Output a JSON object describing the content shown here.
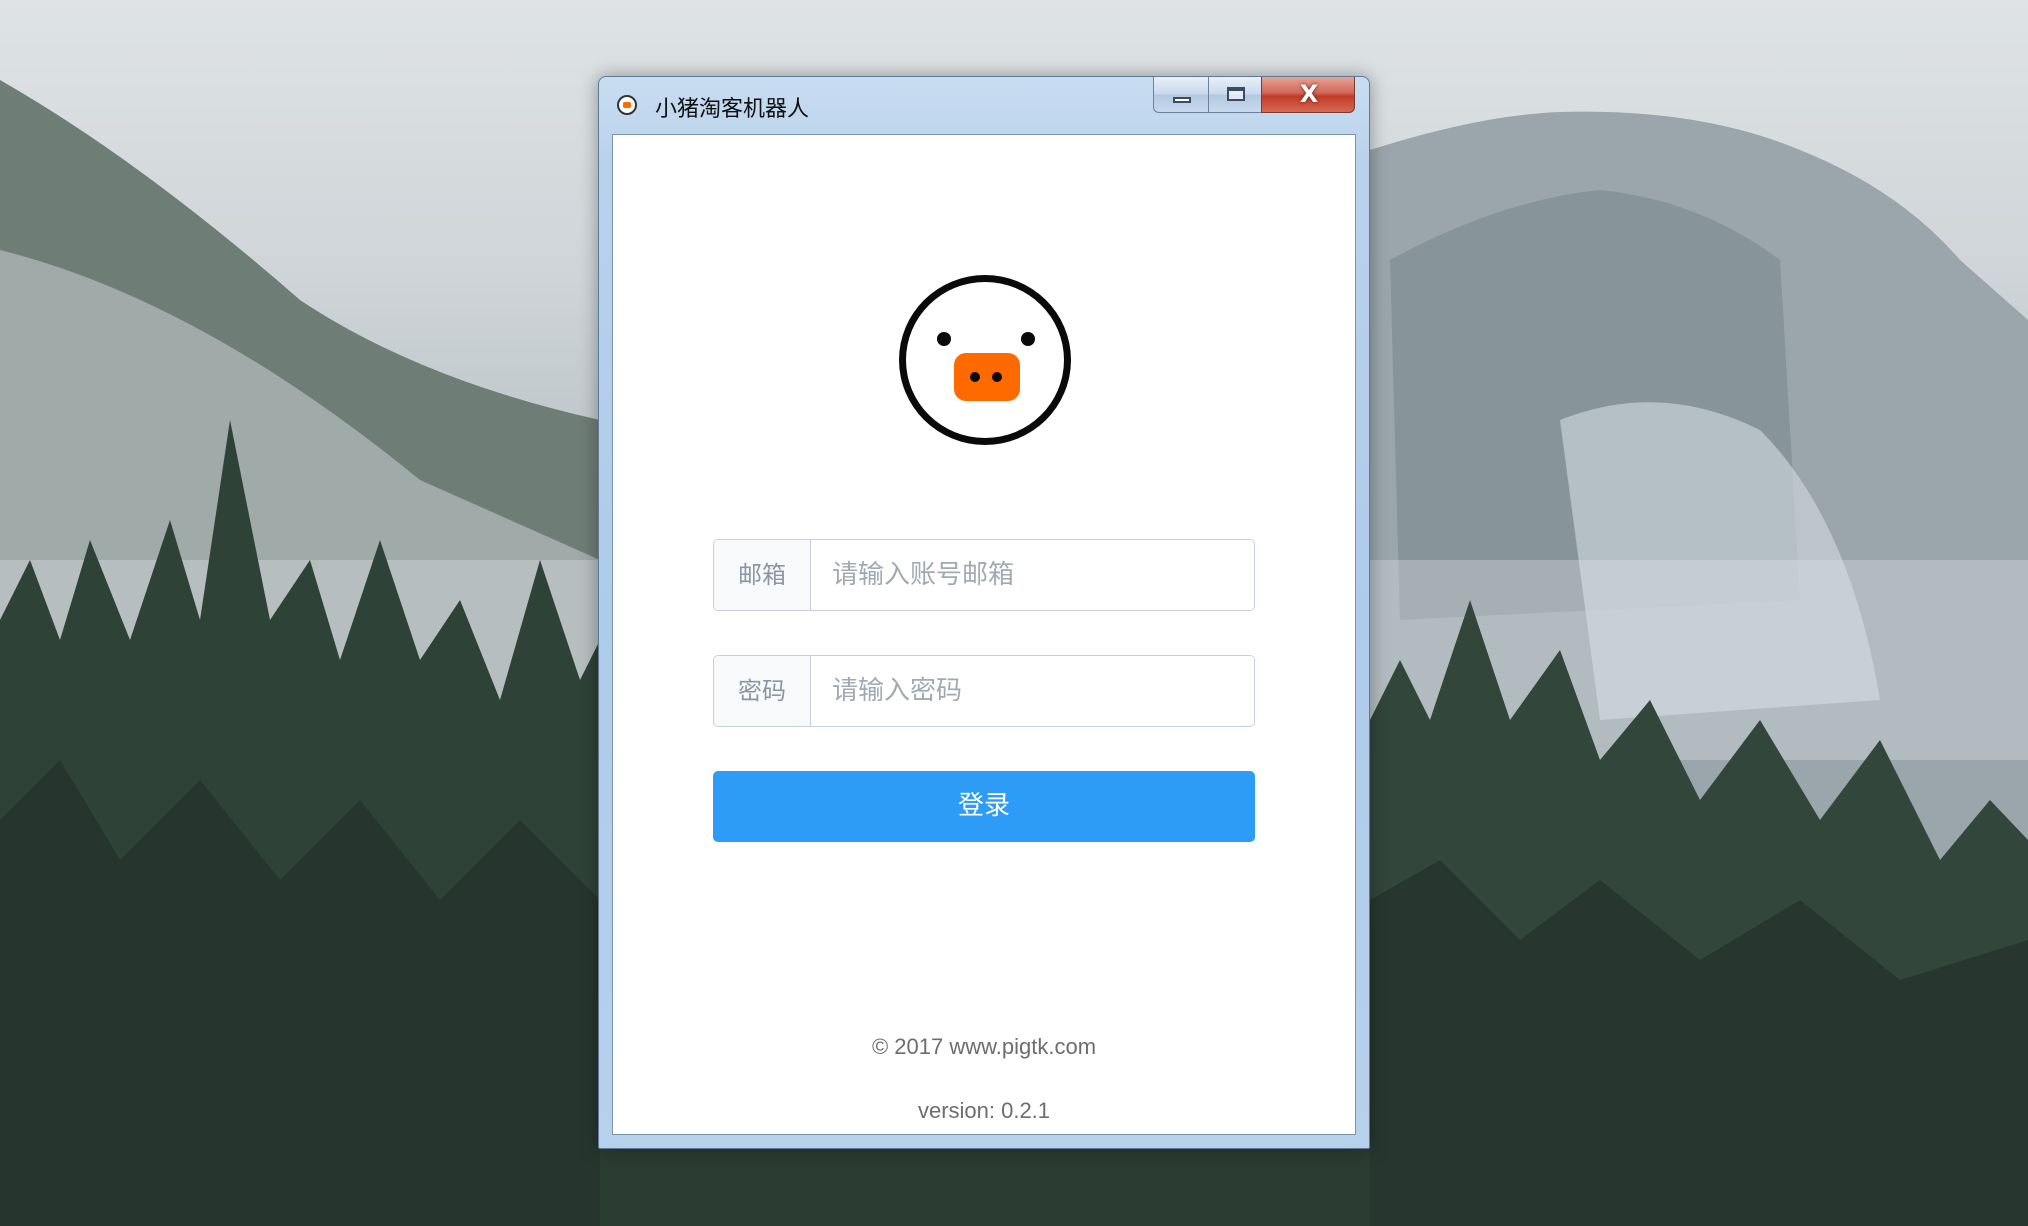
{
  "window": {
    "title": "小猪淘客机器人",
    "controls": {
      "minimize_icon": "minimize-icon",
      "maximize_icon": "maximize-icon",
      "close_label": "X"
    }
  },
  "logo": {
    "icon": "pig-face-icon",
    "snout_color": "#ff6a00"
  },
  "form": {
    "email": {
      "label": "邮箱",
      "placeholder": "请输入账号邮箱",
      "value": ""
    },
    "password": {
      "label": "密码",
      "placeholder": "请输入密码",
      "value": ""
    },
    "submit_label": "登录",
    "submit_color": "#2d9cf6"
  },
  "footer": {
    "copyright": "© 2017 www.pigtk.com",
    "version": "version: 0.2.1"
  }
}
